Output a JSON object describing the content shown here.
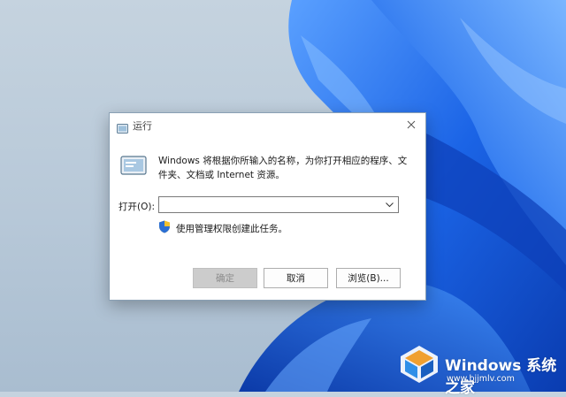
{
  "dialog": {
    "title": "运行",
    "description": "Windows 将根据你所输入的名称，为你打开相应的程序、文件夹、文档或 Internet 资源。",
    "open_label": "打开(O):",
    "open_value": "",
    "admin_note": "使用管理权限创建此任务。",
    "ok_label": "确定",
    "cancel_label": "取消",
    "browse_label": "浏览(B)..."
  },
  "watermark": {
    "title": "Windows 系统之家",
    "url": "www.bjjmlv.com"
  },
  "colors": {
    "wallpaper_blue": "#1a5fe0",
    "wallpaper_bg": "#bccbd9",
    "shield_blue": "#2b6fd4",
    "shield_yellow": "#f2c12e"
  },
  "icons": [
    "run-icon",
    "close-icon",
    "chevron-down-icon",
    "shield-icon",
    "windows-logo-icon"
  ]
}
